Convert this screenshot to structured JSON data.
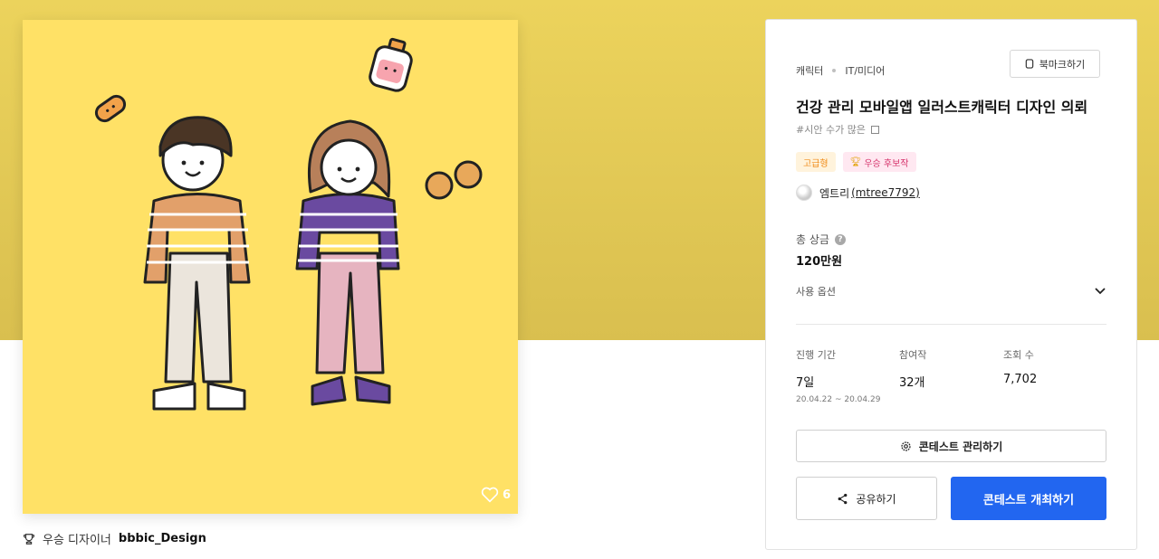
{
  "gallery": {
    "like_count": "6",
    "designer_prefix": "우승 디자이너",
    "designer_name": "bbbic_Design"
  },
  "panel": {
    "categories": [
      "캐릭터",
      "IT/미디어"
    ],
    "bookmark_label": "북마크하기",
    "title": "건강 관리 모바일앱 일러스트캐릭터 디자인 의뢰",
    "tagline": "#시안 수가 많은",
    "badges": {
      "grade": "고급형",
      "award": "우승 후보작"
    },
    "author": {
      "name": "엠트리",
      "handle": "(mtree7792)"
    },
    "prize": {
      "label": "총 상금",
      "value": "120만원"
    },
    "options_label": "사용 옵션",
    "stats": {
      "period": {
        "label": "진행 기간",
        "value": "7일",
        "range": "20.04.22 ~ 20.04.29"
      },
      "entries": {
        "label": "참여작",
        "value": "32개"
      },
      "views": {
        "label": "조회 수",
        "value": "7,702"
      }
    },
    "manage_button": "콘테스트 관리하기",
    "share_button": "공유하기",
    "host_button": "콘테스트 개최하기"
  },
  "colors": {
    "hero_band": "#ecd35c",
    "illustration_bg": "#ffe166",
    "primary": "#2266f0",
    "grade_badge": "#f08c1a",
    "award_badge": "#d6336c"
  },
  "icons": [
    "heart-icon",
    "trophy-icon",
    "bookmark-icon",
    "help-icon",
    "chevron-down-icon",
    "gear-icon",
    "share-icon"
  ]
}
